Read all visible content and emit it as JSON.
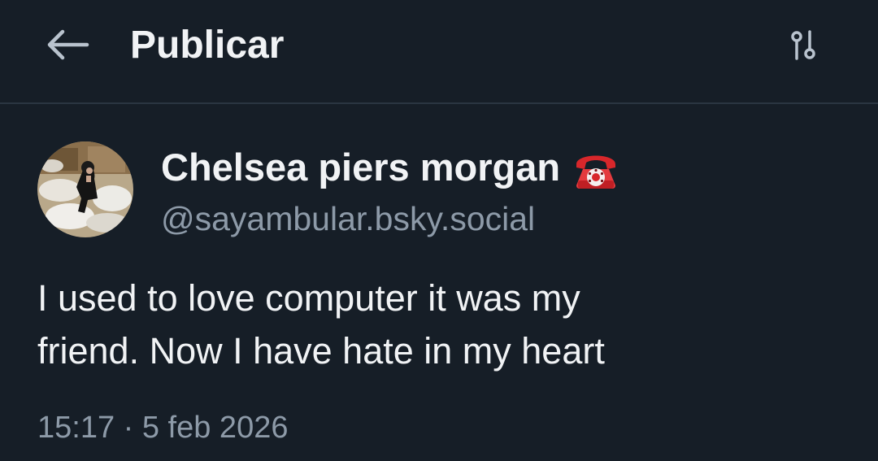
{
  "header": {
    "back_icon": "arrow-left-icon",
    "title": "Publicar",
    "options_icon": "sliders-icon"
  },
  "post": {
    "author": {
      "display_name": "Chelsea piers morgan",
      "name_emoji": "telephone-emoji",
      "handle": "@sayambular.bsky.social",
      "avatar": "profile-photo"
    },
    "text_line_1": "I used to love computer it was my",
    "text_line_2": "friend. Now I have hate in my heart",
    "timestamp": "15:17 · 5 feb 2026"
  },
  "colors": {
    "background": "#161e27",
    "text_primary": "#f1f3f5",
    "text_secondary": "#8d9aa8",
    "divider": "#2a3541"
  }
}
